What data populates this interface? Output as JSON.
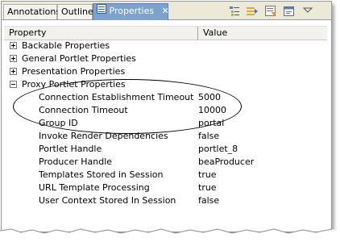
{
  "tabs": [
    {
      "label": "Annotations",
      "active": false
    },
    {
      "label": "Outline",
      "active": false
    },
    {
      "label": "Properties",
      "active": true
    }
  ],
  "toolbar": {
    "icons": [
      "show-categories-icon",
      "show-advanced-icon",
      "filter-icon",
      "restore-default-icon",
      "view-menu-icon"
    ]
  },
  "columns": {
    "property": "Property",
    "value": "Value"
  },
  "categories": [
    {
      "label": "Backable Properties",
      "expanded": false
    },
    {
      "label": "General Portlet Properties",
      "expanded": false
    },
    {
      "label": "Presentation Properties",
      "expanded": false
    },
    {
      "label": "Proxy Portlet Properties",
      "expanded": true
    }
  ],
  "properties": [
    {
      "name": "Connection Establishment Timeout",
      "value": "5000"
    },
    {
      "name": "Connection Timeout",
      "value": "10000"
    },
    {
      "name": "Group ID",
      "value": "portal"
    },
    {
      "name": "Invoke Render Dependencies",
      "value": "false"
    },
    {
      "name": "Portlet Handle",
      "value": "portlet_8"
    },
    {
      "name": "Producer Handle",
      "value": "beaProducer"
    },
    {
      "name": "Templates Stored in Session",
      "value": "true"
    },
    {
      "name": "URL Template Processing",
      "value": "true"
    },
    {
      "name": "User Context Stored In Session",
      "value": "false"
    }
  ],
  "colors": {
    "active_tab": "#7da2ce",
    "tab_bar": "#ece9d8"
  }
}
